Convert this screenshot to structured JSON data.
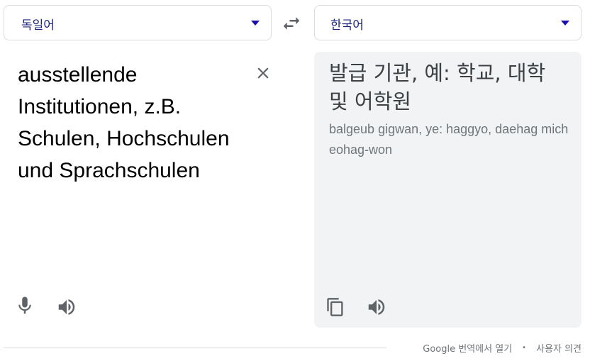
{
  "source_language": {
    "label": "독일어"
  },
  "target_language": {
    "label": "한국어"
  },
  "source_text": "ausstellende Institutionen, z.B. Schulen, Hochschulen und Sprachschulen",
  "translation": {
    "text": "발급 기관, 예: 학교, 대학 및 어학원",
    "romanization": "balgeub gigwan, ye: haggyo, daehag mich eohag-won"
  },
  "footer": {
    "open_in_translate": "Google 번역에서 열기",
    "separator": "•",
    "feedback": "사용자 의견"
  },
  "colors": {
    "accent": "#1a0dab",
    "target_panel_bg": "#f1f3f4",
    "border": "#dadce0"
  },
  "icons": {
    "swap": "swap-arrows-icon",
    "clear": "close-icon",
    "mic": "microphone-icon",
    "speaker": "speaker-icon",
    "copy": "copy-icon",
    "dropdown": "dropdown-arrow-icon"
  }
}
